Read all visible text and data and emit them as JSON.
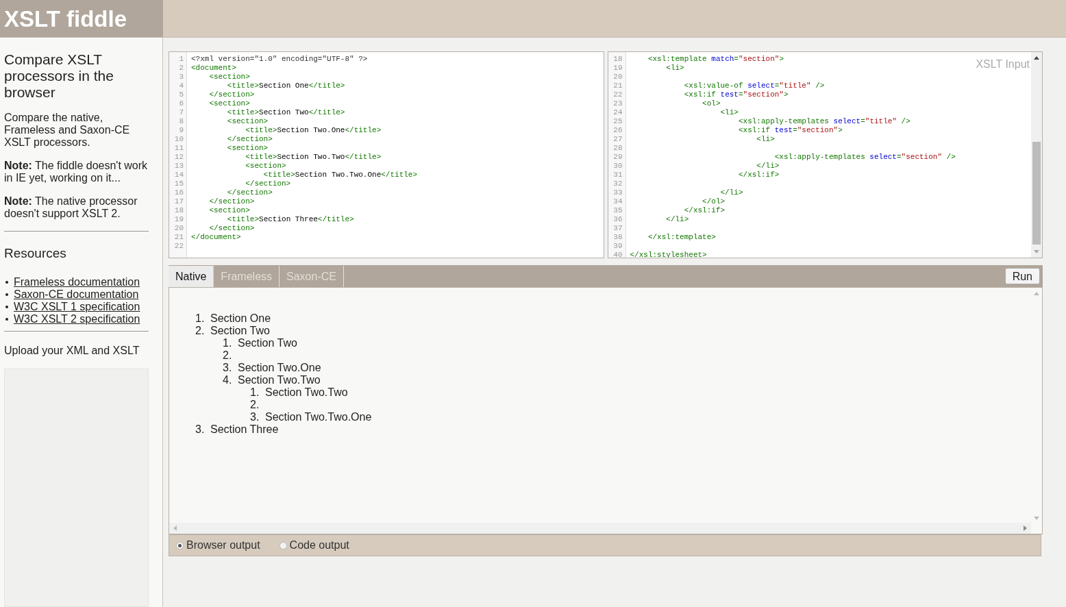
{
  "header": {
    "title": "XSLT fiddle"
  },
  "sidebar": {
    "heading": "Compare XSLT processors in the browser",
    "paragraphs": [
      "Compare the native, Frameless and Saxon-CE XSLT processors.",
      "**Note:** The fiddle doesn't work in IE yet, working on it...",
      "**Note:** The native processor doesn't support XSLT 2."
    ],
    "resources_heading": "Resources",
    "links": [
      "Frameless documentation",
      "Saxon-CE documentation",
      "W3C XSLT 1 specification",
      "W3C XSLT 2 specification"
    ],
    "upload_label": "Upload your XML and XSLT"
  },
  "xml_editor": {
    "lines": [
      {
        "number": "1",
        "tokens": [
          {
            "kind": "meta",
            "text": "<?xml version=\"1.0\" encoding=\"UTF-8\" ?>"
          }
        ]
      },
      {
        "number": "2",
        "tokens": [
          {
            "kind": "tag",
            "text": "<document>"
          }
        ]
      },
      {
        "number": "3",
        "tokens": [
          {
            "kind": "tag",
            "text": "    <section>"
          }
        ]
      },
      {
        "number": "4",
        "tokens": [
          {
            "kind": "tag",
            "text": "        <title>"
          },
          {
            "kind": "text",
            "text": "Section One"
          },
          {
            "kind": "tag",
            "text": "</title>"
          }
        ]
      },
      {
        "number": "5",
        "tokens": [
          {
            "kind": "tag",
            "text": "    </section>"
          }
        ]
      },
      {
        "number": "6",
        "tokens": [
          {
            "kind": "tag",
            "text": "    <section>"
          }
        ]
      },
      {
        "number": "7",
        "tokens": [
          {
            "kind": "tag",
            "text": "        <title>"
          },
          {
            "kind": "text",
            "text": "Section Two"
          },
          {
            "kind": "tag",
            "text": "</title>"
          }
        ]
      },
      {
        "number": "8",
        "tokens": [
          {
            "kind": "tag",
            "text": "        <section>"
          }
        ]
      },
      {
        "number": "9",
        "tokens": [
          {
            "kind": "tag",
            "text": "            <title>"
          },
          {
            "kind": "text",
            "text": "Section Two.One"
          },
          {
            "kind": "tag",
            "text": "</title>"
          }
        ]
      },
      {
        "number": "10",
        "tokens": [
          {
            "kind": "tag",
            "text": "        </section>"
          }
        ]
      },
      {
        "number": "11",
        "tokens": [
          {
            "kind": "tag",
            "text": "        <section>"
          }
        ]
      },
      {
        "number": "12",
        "tokens": [
          {
            "kind": "tag",
            "text": "            <title>"
          },
          {
            "kind": "text",
            "text": "Section Two.Two"
          },
          {
            "kind": "tag",
            "text": "</title>"
          }
        ]
      },
      {
        "number": "13",
        "tokens": [
          {
            "kind": "tag",
            "text": "            <section>"
          }
        ]
      },
      {
        "number": "14",
        "tokens": [
          {
            "kind": "tag",
            "text": "                <title>"
          },
          {
            "kind": "text",
            "text": "Section Two.Two.One"
          },
          {
            "kind": "tag",
            "text": "</title>"
          }
        ]
      },
      {
        "number": "15",
        "tokens": [
          {
            "kind": "tag",
            "text": "            </section>"
          }
        ]
      },
      {
        "number": "16",
        "tokens": [
          {
            "kind": "tag",
            "text": "        </section>"
          }
        ]
      },
      {
        "number": "17",
        "tokens": [
          {
            "kind": "tag",
            "text": "    </section>"
          }
        ]
      },
      {
        "number": "18",
        "tokens": [
          {
            "kind": "tag",
            "text": "    <section>"
          }
        ]
      },
      {
        "number": "19",
        "tokens": [
          {
            "kind": "tag",
            "text": "        <title>"
          },
          {
            "kind": "text",
            "text": "Section Three"
          },
          {
            "kind": "tag",
            "text": "</title>"
          }
        ]
      },
      {
        "number": "20",
        "tokens": [
          {
            "kind": "tag",
            "text": "    </section>"
          }
        ]
      },
      {
        "number": "21",
        "tokens": [
          {
            "kind": "tag",
            "text": "</document>"
          }
        ]
      },
      {
        "number": "22"
      }
    ]
  },
  "xslt_editor": {
    "label": "XSLT Input",
    "lines": [
      {
        "number": "18",
        "tokens": [
          {
            "kind": "tag",
            "text": "    <xsl:template "
          },
          {
            "kind": "attr",
            "text": "match"
          },
          {
            "kind": "tag",
            "text": "="
          },
          {
            "kind": "string",
            "text": "\"section\""
          },
          {
            "kind": "tag",
            "text": ">"
          }
        ]
      },
      {
        "number": "19",
        "tokens": [
          {
            "kind": "tag",
            "text": "        <li>"
          }
        ]
      },
      {
        "number": "20"
      },
      {
        "number": "21",
        "tokens": [
          {
            "kind": "tag",
            "text": "            <xsl:value-of "
          },
          {
            "kind": "attr",
            "text": "select"
          },
          {
            "kind": "tag",
            "text": "="
          },
          {
            "kind": "string",
            "text": "\"title\""
          },
          {
            "kind": "tag",
            "text": " />"
          }
        ]
      },
      {
        "number": "22",
        "tokens": [
          {
            "kind": "tag",
            "text": "            <xsl:if "
          },
          {
            "kind": "attr",
            "text": "test"
          },
          {
            "kind": "tag",
            "text": "="
          },
          {
            "kind": "string",
            "text": "\"section\""
          },
          {
            "kind": "tag",
            "text": ">"
          }
        ]
      },
      {
        "number": "23",
        "tokens": [
          {
            "kind": "tag",
            "text": "                <ol>"
          }
        ]
      },
      {
        "number": "24",
        "tokens": [
          {
            "kind": "tag",
            "text": "                    <li>"
          }
        ]
      },
      {
        "number": "25",
        "tokens": [
          {
            "kind": "tag",
            "text": "                        <xsl:apply-templates "
          },
          {
            "kind": "attr",
            "text": "select"
          },
          {
            "kind": "tag",
            "text": "="
          },
          {
            "kind": "string",
            "text": "\"title\""
          },
          {
            "kind": "tag",
            "text": " />"
          }
        ]
      },
      {
        "number": "26",
        "tokens": [
          {
            "kind": "tag",
            "text": "                        <xsl:if "
          },
          {
            "kind": "attr",
            "text": "test"
          },
          {
            "kind": "tag",
            "text": "="
          },
          {
            "kind": "string",
            "text": "\"section\""
          },
          {
            "kind": "tag",
            "text": ">"
          }
        ]
      },
      {
        "number": "27",
        "tokens": [
          {
            "kind": "tag",
            "text": "                            <li>"
          }
        ]
      },
      {
        "number": "28"
      },
      {
        "number": "29",
        "tokens": [
          {
            "kind": "tag",
            "text": "                                <xsl:apply-templates "
          },
          {
            "kind": "attr",
            "text": "select"
          },
          {
            "kind": "tag",
            "text": "="
          },
          {
            "kind": "string",
            "text": "\"section\""
          },
          {
            "kind": "tag",
            "text": " />"
          }
        ]
      },
      {
        "number": "30",
        "tokens": [
          {
            "kind": "tag",
            "text": "                            </li>"
          }
        ]
      },
      {
        "number": "31",
        "tokens": [
          {
            "kind": "tag",
            "text": "                        </xsl:if>"
          }
        ]
      },
      {
        "number": "32"
      },
      {
        "number": "33",
        "tokens": [
          {
            "kind": "tag",
            "text": "                    </li>"
          }
        ]
      },
      {
        "number": "34",
        "tokens": [
          {
            "kind": "tag",
            "text": "                </ol>"
          }
        ]
      },
      {
        "number": "35",
        "tokens": [
          {
            "kind": "tag",
            "text": "            </xsl:if>"
          }
        ]
      },
      {
        "number": "36",
        "tokens": [
          {
            "kind": "tag",
            "text": "        </li>"
          }
        ]
      },
      {
        "number": "37"
      },
      {
        "number": "38",
        "tokens": [
          {
            "kind": "tag",
            "text": "    </xsl:template>"
          }
        ]
      },
      {
        "number": "39"
      },
      {
        "number": "40",
        "tokens": [
          {
            "kind": "tag",
            "text": "</xsl:stylesheet>"
          }
        ]
      }
    ]
  },
  "tabs": [
    {
      "label": "Native",
      "selected": true
    },
    {
      "label": "Frameless",
      "selected": false
    },
    {
      "label": "Saxon-CE",
      "selected": false
    }
  ],
  "run_button": "Run",
  "output": {
    "items": [
      {
        "marker": "1.",
        "text": "Section One"
      },
      {
        "marker": "2.",
        "text": "Section Two",
        "children": [
          {
            "marker": "1.",
            "text": "Section Two"
          },
          {
            "marker": "2."
          },
          {
            "marker": "3.",
            "text": "Section Two.One"
          },
          {
            "marker": "4.",
            "text": "Section Two.Two",
            "children": [
              {
                "marker": "1.",
                "text": "Section Two.Two"
              },
              {
                "marker": "2."
              },
              {
                "marker": "3.",
                "text": "Section Two.Two.One"
              }
            ]
          }
        ]
      },
      {
        "marker": "3.",
        "text": "Section Three"
      }
    ]
  },
  "output_modes": [
    {
      "label": "Browser output",
      "selected": true
    },
    {
      "label": "Code output",
      "selected": false
    }
  ]
}
